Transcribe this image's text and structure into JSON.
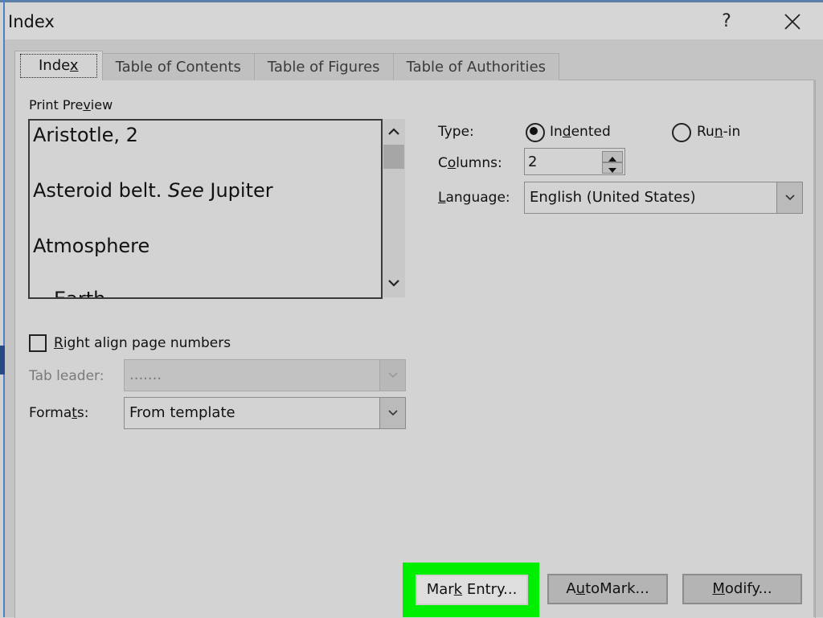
{
  "window": {
    "title": "Index",
    "help_label": "?",
    "close_icon": "close-icon"
  },
  "tabs": [
    {
      "label": "Index",
      "active": true
    },
    {
      "label": "Table of Contents",
      "active": false
    },
    {
      "label": "Table of Figures",
      "active": false
    },
    {
      "label": "Table of Authorities",
      "active": false
    }
  ],
  "preview": {
    "label_pre": "Print Pre",
    "label_u": "v",
    "label_post": "iew",
    "entries": [
      {
        "text": "Aristotle, 2"
      },
      {
        "text_pre": "Asteroid belt. ",
        "text_italic": "See",
        "text_post": " Jupiter"
      },
      {
        "text": "Atmosphere"
      },
      {
        "text": "Earth"
      }
    ]
  },
  "type": {
    "label": "Type:",
    "options": [
      {
        "pre": "In",
        "u": "d",
        "post": "ented",
        "checked": true
      },
      {
        "pre": "Ru",
        "u": "n",
        "post": "-in",
        "checked": false
      }
    ]
  },
  "columns": {
    "label_pre": "C",
    "label_u": "o",
    "label_post": "lumns:",
    "value": "2"
  },
  "language": {
    "label_u": "L",
    "label_post": "anguage:",
    "value": "English (United States)"
  },
  "right_align": {
    "label_u": "R",
    "label_post": "ight align page numbers",
    "checked": false
  },
  "tab_leader": {
    "label": "Tab leader:",
    "value": ".......",
    "disabled": true
  },
  "formats": {
    "label_pre": "Forma",
    "label_u": "t",
    "label_post": "s:",
    "value": "From template"
  },
  "buttons": {
    "mark_entry": {
      "pre": "Mar",
      "u": "k",
      "post": " Entry..."
    },
    "automark": {
      "pre": "A",
      "u": "u",
      "post": "toMark..."
    },
    "modify": {
      "pre": "",
      "u": "M",
      "post": "odify..."
    }
  },
  "colors": {
    "highlight": "#00ee00",
    "dialog_bg": "#d3d3d3",
    "window_edge": "#4f7fc4"
  }
}
